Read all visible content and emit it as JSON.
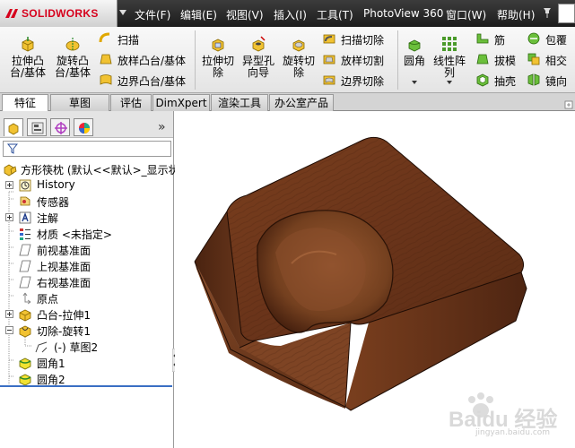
{
  "app": {
    "logo_text": "SOLIDWORKS",
    "brand_color": "#d6001c"
  },
  "menu": [
    "文件(F)",
    "编辑(E)",
    "视图(V)",
    "插入(I)",
    "工具(T)",
    "PhotoView 360",
    "窗口(W)",
    "帮助(H)"
  ],
  "toolbar": {
    "extrude_boss": "拉伸凸\n台/基体",
    "revolve_boss": "旋转凸\n台/基体",
    "sweep": "扫描",
    "loft_boss": "放样凸台/基体",
    "boundary_boss": "边界凸台/基体",
    "extrude_cut": "拉伸切\n除",
    "hole_wizard": "异型孔\n向导",
    "revolve_cut": "旋转切\n除",
    "swept_cut": "扫描切除",
    "lofted_cut": "放样切割",
    "boundary_cut": "边界切除",
    "fillet": "圆角",
    "linear_pattern": "线性阵\n列",
    "rib": "筋",
    "draft": "拔模",
    "shell": "抽壳",
    "wrap": "包覆",
    "intersect": "相交",
    "mirror": "镜向"
  },
  "tabs": [
    {
      "label": "特征",
      "active": true
    },
    {
      "label": "草图",
      "active": false
    },
    {
      "label": "评估",
      "active": false
    },
    {
      "label": "DimXpert",
      "active": false
    },
    {
      "label": "渲染工具",
      "active": false
    },
    {
      "label": "办公室产品",
      "active": false
    }
  ],
  "panel": {
    "expand_label": "»"
  },
  "tree": {
    "root": "方形筷枕  (默认<<默认>_显示状",
    "items": [
      {
        "label": "History",
        "icon": "history-icon"
      },
      {
        "label": "传感器",
        "icon": "sensor-icon"
      },
      {
        "label": "注解",
        "icon": "annotation-icon"
      },
      {
        "label": "材质 <未指定>",
        "icon": "material-icon"
      },
      {
        "label": "前视基准面",
        "icon": "plane-icon"
      },
      {
        "label": "上视基准面",
        "icon": "plane-icon"
      },
      {
        "label": "右视基准面",
        "icon": "plane-icon"
      },
      {
        "label": "原点",
        "icon": "origin-icon"
      },
      {
        "label": "凸台-拉伸1",
        "icon": "extrude-icon"
      },
      {
        "label": "切除-旋转1",
        "icon": "revolve-cut-icon"
      },
      {
        "label": "(-) 草图2",
        "icon": "sketch-icon"
      },
      {
        "label": "圆角1",
        "icon": "fillet-icon"
      },
      {
        "label": "圆角2",
        "icon": "fillet-icon"
      }
    ]
  },
  "colors": {
    "wood_dark": "#4a2310",
    "wood_mid": "#6e3a1e",
    "wood_light": "#8a4d2a",
    "rollback_bar": "#3a6fc4"
  },
  "watermark": {
    "text": "Baidu 经验",
    "url": "jingyan.baidu.com"
  }
}
